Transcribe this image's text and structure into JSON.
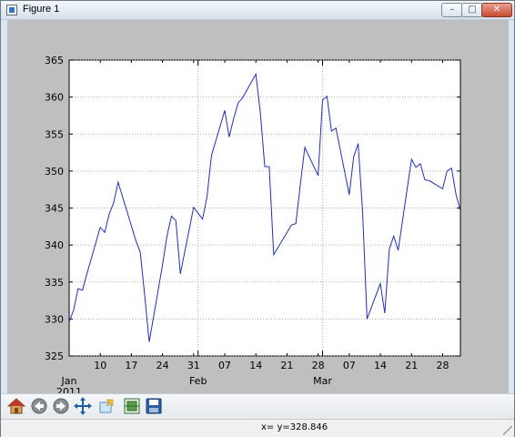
{
  "window": {
    "title": "Figure 1",
    "buttons": {
      "minimize": "–",
      "maximize": "□",
      "close": "✕"
    }
  },
  "toolbar": {
    "tools": [
      {
        "name": "home",
        "icon": "home-icon"
      },
      {
        "name": "back",
        "icon": "back-arrow-icon"
      },
      {
        "name": "forward",
        "icon": "forward-arrow-icon"
      },
      {
        "name": "pan",
        "icon": "pan-move-icon"
      },
      {
        "name": "zoom",
        "icon": "zoom-rect-icon"
      },
      {
        "name": "configure",
        "icon": "subplots-config-icon"
      },
      {
        "name": "save",
        "icon": "save-disk-icon"
      }
    ]
  },
  "status": {
    "text": "x= y=328.846"
  },
  "colors": {
    "line": "#1f2fbf",
    "figure_bg": "#bfbfbf",
    "axes_bg": "#ffffff",
    "grid": "#9a9a9a"
  },
  "chart_data": {
    "type": "line",
    "title": "",
    "xlabel": "",
    "ylabel": "",
    "ylim": [
      325,
      365
    ],
    "yticks": [
      325,
      330,
      335,
      340,
      345,
      350,
      355,
      360,
      365
    ],
    "xlim": [
      "2011-01-03",
      "2011-04-01"
    ],
    "x_tick_dates": [
      "2011-01-10",
      "2011-01-17",
      "2011-01-24",
      "2011-01-31",
      "2011-02-07",
      "2011-02-14",
      "2011-02-21",
      "2011-02-28",
      "2011-03-07",
      "2011-03-14",
      "2011-03-21",
      "2011-03-28"
    ],
    "x_tick_labels": [
      "10",
      "17",
      "24",
      "31",
      "07",
      "14",
      "21",
      "28",
      "07",
      "14",
      "21",
      "28"
    ],
    "major_tick_dates": [
      "2011-01-03",
      "2011-02-01",
      "2011-03-01"
    ],
    "major_tick_labels": [
      "Jan\n2011",
      "Feb",
      "Mar"
    ],
    "grid": true,
    "series": [
      {
        "x": [
          "2011-01-03",
          "2011-01-04",
          "2011-01-05",
          "2011-01-06",
          "2011-01-07",
          "2011-01-10",
          "2011-01-11",
          "2011-01-12",
          "2011-01-13",
          "2011-01-14",
          "2011-01-18",
          "2011-01-19",
          "2011-01-20",
          "2011-01-21",
          "2011-01-24",
          "2011-01-25",
          "2011-01-26",
          "2011-01-27",
          "2011-01-28",
          "2011-01-31",
          "2011-02-01",
          "2011-02-02",
          "2011-02-03",
          "2011-02-04",
          "2011-02-07",
          "2011-02-08",
          "2011-02-09",
          "2011-02-10",
          "2011-02-11",
          "2011-02-14",
          "2011-02-15",
          "2011-02-16",
          "2011-02-17",
          "2011-02-18",
          "2011-02-22",
          "2011-02-23",
          "2011-02-24",
          "2011-02-25",
          "2011-02-28",
          "2011-03-01",
          "2011-03-02",
          "2011-03-03",
          "2011-03-04",
          "2011-03-07",
          "2011-03-08",
          "2011-03-09",
          "2011-03-10",
          "2011-03-11",
          "2011-03-14",
          "2011-03-15",
          "2011-03-16",
          "2011-03-17",
          "2011-03-18",
          "2011-03-21",
          "2011-03-22",
          "2011-03-23",
          "2011-03-24",
          "2011-03-25",
          "2011-03-28",
          "2011-03-29",
          "2011-03-30",
          "2011-03-31",
          "2011-04-01"
        ],
        "values": [
          329.6,
          331.2,
          334.1,
          333.9,
          336.1,
          342.4,
          341.7,
          344.2,
          345.7,
          348.5,
          340.6,
          339.0,
          333.1,
          326.9,
          337.3,
          341.2,
          343.9,
          343.3,
          336.1,
          345.1,
          344.3,
          343.5,
          346.5,
          352.1,
          358.2,
          354.6,
          357.1,
          359.2,
          359.9,
          363.1,
          357.9,
          350.6,
          350.6,
          338.7,
          342.7,
          342.9,
          348.2,
          353.2,
          349.4,
          359.6,
          360.1,
          355.4,
          355.8,
          346.8,
          351.9,
          353.7,
          344.5,
          330.0,
          334.8,
          330.8,
          339.4,
          341.2,
          339.3,
          351.6,
          350.5,
          351.0,
          348.8,
          348.7,
          347.6,
          350.0,
          350.4,
          346.9,
          344.6
        ]
      }
    ]
  }
}
